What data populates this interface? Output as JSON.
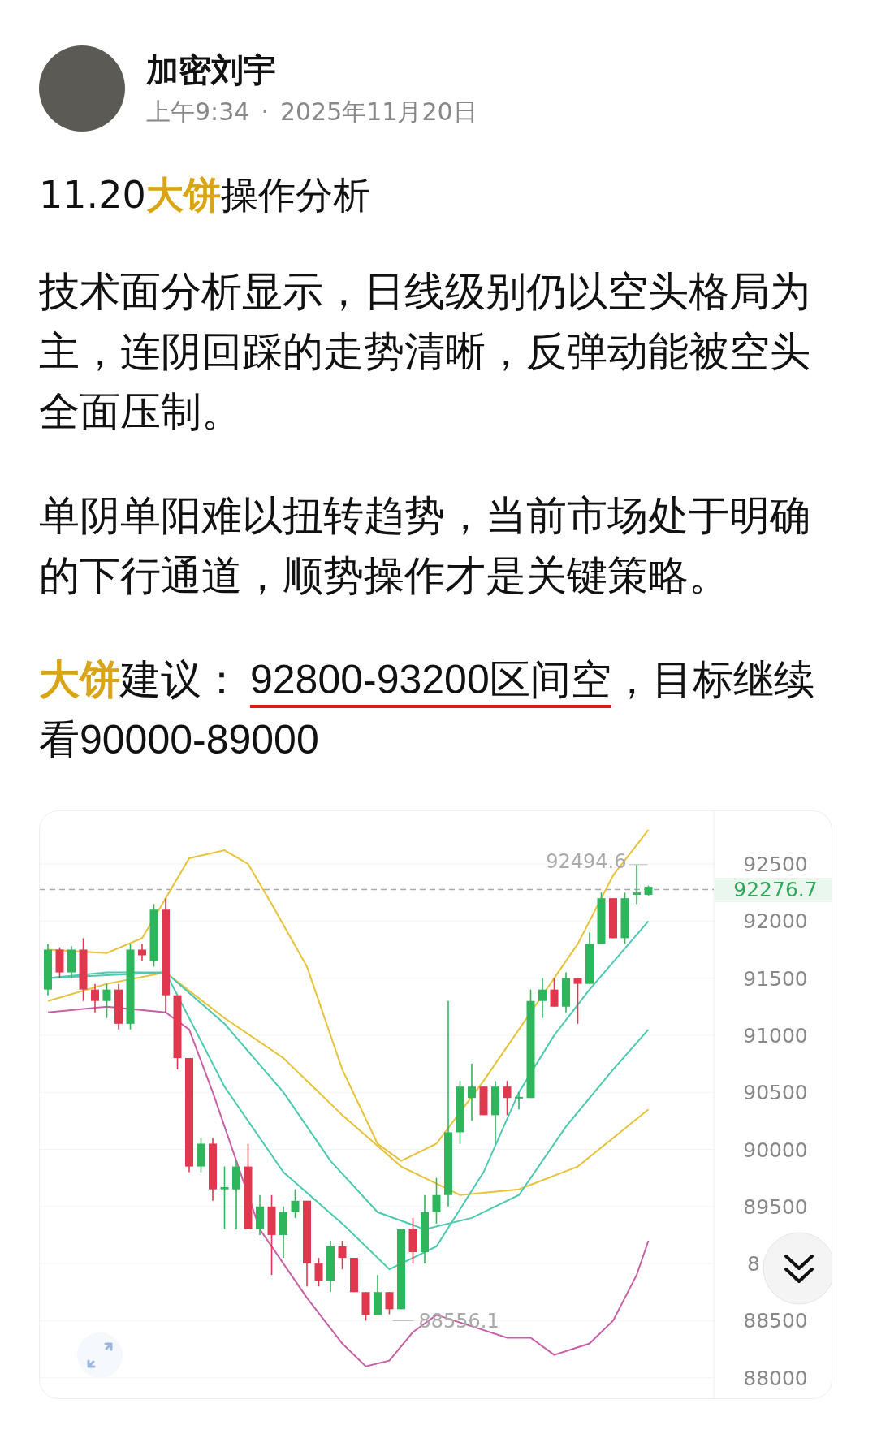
{
  "author": {
    "name": "加密刘宇",
    "time": "上午9:34",
    "separator": "·",
    "date": "2025年11月20日"
  },
  "title": [
    {
      "text": "11.20",
      "highlight": false
    },
    {
      "text": "大饼",
      "highlight": true
    },
    {
      "text": "操作分析",
      "highlight": false
    }
  ],
  "paragraphs": [
    "技术面分析显示，日线级别仍以空头格局为主，连阴回踩的走势清晰，反弹动能被空头全面压制。",
    "单阴单阳难以扭转趋势，当前市场处于明确的下行通道，顺势操作才是关键策略。"
  ],
  "advice": [
    {
      "kind": "highlight",
      "text": "大饼"
    },
    {
      "kind": "plain",
      "text": "建议："
    },
    {
      "kind": "underline",
      "text": "92800-93200区间空"
    },
    {
      "kind": "plain",
      "text": "，目标继续看90000-89000"
    }
  ],
  "chart": {
    "price_labels": [
      {
        "text": "92500",
        "partial": false
      },
      {
        "text": "92000",
        "partial": false
      },
      {
        "text": "91500",
        "partial": false
      },
      {
        "text": "91000",
        "partial": false
      },
      {
        "text": "90500",
        "partial": false
      },
      {
        "text": "90000",
        "partial": false
      },
      {
        "text": "89500",
        "partial": false
      },
      {
        "text": "8",
        "partial": true
      },
      {
        "text": "88500",
        "partial": false
      },
      {
        "text": "88000",
        "partial": false
      }
    ],
    "current_price": "92276.7",
    "high_label": "92494.6",
    "low_label": "88556.1"
  }
}
